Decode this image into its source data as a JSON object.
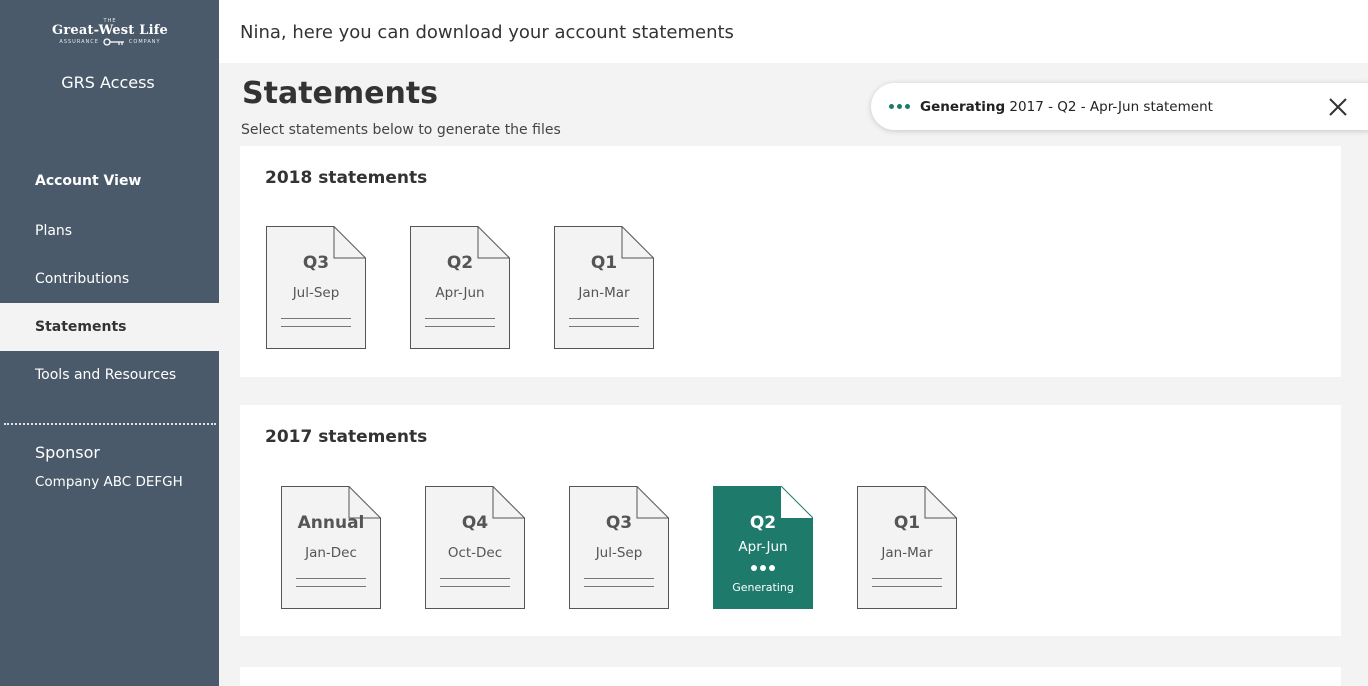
{
  "brand": {
    "logo_top": "THE",
    "logo_main": "Great-West Life",
    "logo_left": "ASSURANCE",
    "logo_right": "COMPANY",
    "app_name": "GRS Access"
  },
  "nav": {
    "items": [
      {
        "label": "Account View"
      },
      {
        "label": "Plans"
      },
      {
        "label": "Contributions"
      },
      {
        "label": "Statements"
      },
      {
        "label": "Tools and Resources"
      }
    ]
  },
  "sponsor": {
    "label": "Sponsor",
    "value": "Company ABC DEFGH"
  },
  "header": {
    "text": "Nina, here you can download your account statements"
  },
  "page": {
    "title": "Statements",
    "subtitle": "Select statements below to generate the files"
  },
  "toast": {
    "bold": "Generating",
    "text": " 2017 - Q2 - Apr-Jun statement"
  },
  "sections": [
    {
      "title": "2018 statements",
      "docs": [
        {
          "period": "Q3",
          "range": "Jul-Sep"
        },
        {
          "period": "Q2",
          "range": "Apr-Jun"
        },
        {
          "period": "Q1",
          "range": "Jan-Mar"
        }
      ]
    },
    {
      "title": "2017 statements",
      "docs": [
        {
          "period": "Annual",
          "range": "Jan-Dec"
        },
        {
          "period": "Q4",
          "range": "Oct-Dec"
        },
        {
          "period": "Q3",
          "range": "Jul-Sep"
        },
        {
          "period": "Q2",
          "range": "Apr-Jun",
          "status": "Generating"
        },
        {
          "period": "Q1",
          "range": "Jan-Mar"
        }
      ]
    }
  ],
  "colors": {
    "sidebar": "#4a5a6a",
    "accent": "#1e7a6a",
    "background": "#f3f3f3"
  }
}
